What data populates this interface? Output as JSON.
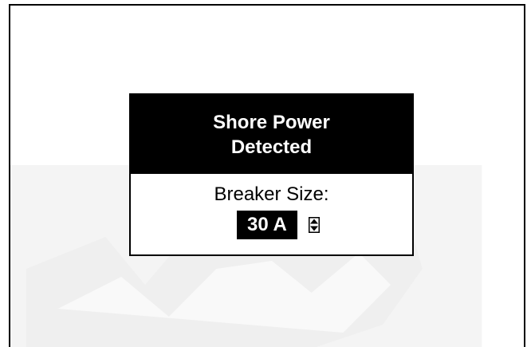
{
  "dialog": {
    "title_line1": "Shore Power",
    "title_line2": "Detected",
    "breaker_label": "Breaker Size:",
    "breaker_value": "30 A"
  },
  "icons": {
    "stepper": "up-down-stepper-icon"
  },
  "colors": {
    "header_bg": "#000000",
    "header_text": "#ffffff",
    "watermark": "#f5f5f5"
  }
}
